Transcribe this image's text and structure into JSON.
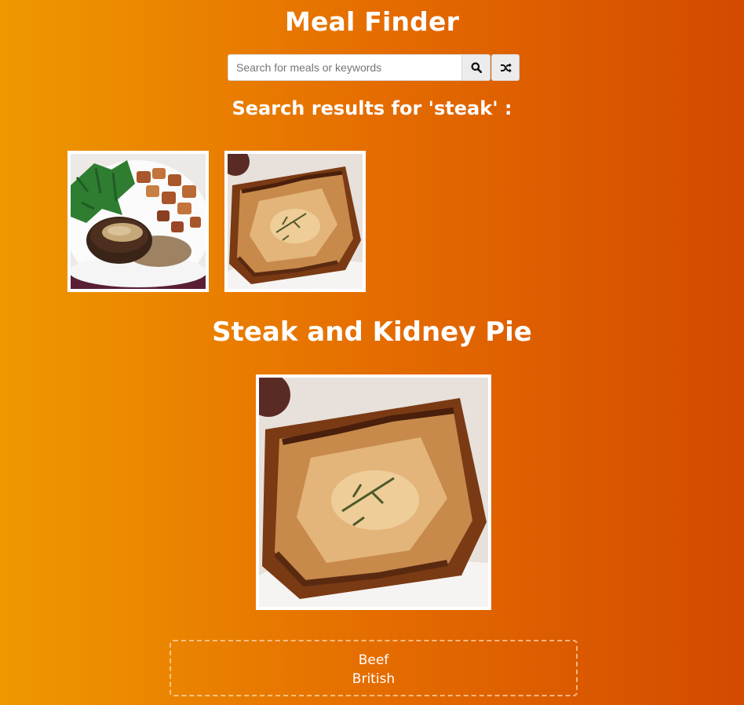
{
  "app": {
    "title": "Meal Finder"
  },
  "search": {
    "placeholder": "Search for meals or keywords",
    "value": "",
    "search_icon": "search-icon",
    "random_icon": "shuffle-icon"
  },
  "results": {
    "heading": "Search results for 'steak' :",
    "items": [
      {
        "image": "steak-with-potatoes-photo"
      },
      {
        "image": "steak-and-kidney-pie-photo"
      }
    ]
  },
  "meal": {
    "title": "Steak and Kidney Pie",
    "image": "steak-and-kidney-pie-photo",
    "category": "Beef",
    "area": "British"
  },
  "colors": {
    "background_start": "#ef9800",
    "background_end": "#d34a00",
    "text": "#ffffff",
    "button_bg": "#ececec"
  }
}
